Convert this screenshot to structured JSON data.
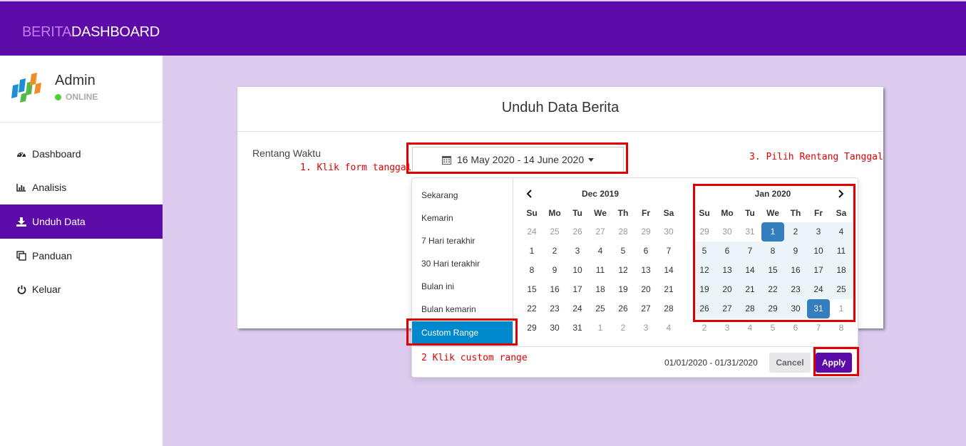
{
  "app": {
    "brand_part1": "BERITA",
    "brand_part2": "DASHBOARD"
  },
  "user": {
    "name": "Admin",
    "status": "ONLINE"
  },
  "sidebar": {
    "items": [
      {
        "label": "Dashboard",
        "icon": "dashboard-icon"
      },
      {
        "label": "Analisis",
        "icon": "bar-chart-icon"
      },
      {
        "label": "Unduh Data",
        "icon": "download-icon",
        "active": true
      },
      {
        "label": "Panduan",
        "icon": "copy-icon"
      },
      {
        "label": "Keluar",
        "icon": "power-icon"
      }
    ]
  },
  "card": {
    "title": "Unduh Data Berita",
    "field_label": "Rentang Waktu",
    "date_value": "16 May 2020 - 14 June 2020"
  },
  "annotations": {
    "step1": "1. Klik form tanggal",
    "step2": "2 Klik custom range",
    "step3": "3. Pilih Rentang Tanggal"
  },
  "picker": {
    "ranges": [
      "Sekarang",
      "Kemarin",
      "7 Hari terakhir",
      "30 Hari terakhir",
      "Bulan ini",
      "Bulan kemarin",
      "Custom Range"
    ],
    "active_range": "Custom Range",
    "dow": [
      "Su",
      "Mo",
      "Tu",
      "We",
      "Th",
      "Fr",
      "Sa"
    ],
    "left_month": "Dec 2019",
    "right_month": "Jan 2020",
    "left_days": [
      [
        "24",
        "o"
      ],
      [
        "25",
        "o"
      ],
      [
        "26",
        "o"
      ],
      [
        "27",
        "o"
      ],
      [
        "28",
        "o"
      ],
      [
        "29",
        "o"
      ],
      [
        "30",
        "o"
      ],
      [
        "1",
        ""
      ],
      [
        "2",
        ""
      ],
      [
        "3",
        ""
      ],
      [
        "4",
        ""
      ],
      [
        "5",
        ""
      ],
      [
        "6",
        ""
      ],
      [
        "7",
        ""
      ],
      [
        "8",
        ""
      ],
      [
        "9",
        ""
      ],
      [
        "10",
        ""
      ],
      [
        "11",
        ""
      ],
      [
        "12",
        ""
      ],
      [
        "13",
        ""
      ],
      [
        "14",
        ""
      ],
      [
        "15",
        ""
      ],
      [
        "16",
        ""
      ],
      [
        "17",
        ""
      ],
      [
        "18",
        ""
      ],
      [
        "19",
        ""
      ],
      [
        "20",
        ""
      ],
      [
        "21",
        ""
      ],
      [
        "22",
        ""
      ],
      [
        "23",
        ""
      ],
      [
        "24",
        ""
      ],
      [
        "25",
        ""
      ],
      [
        "26",
        ""
      ],
      [
        "27",
        ""
      ],
      [
        "28",
        ""
      ],
      [
        "29",
        ""
      ],
      [
        "30",
        ""
      ],
      [
        "31",
        ""
      ],
      [
        "1",
        "o"
      ],
      [
        "2",
        "o"
      ],
      [
        "3",
        "o"
      ],
      [
        "4",
        "o"
      ]
    ],
    "right_days": [
      [
        "29",
        "o"
      ],
      [
        "30",
        "o"
      ],
      [
        "31",
        "o"
      ],
      [
        "1",
        "s"
      ],
      [
        "2",
        "r"
      ],
      [
        "3",
        "r"
      ],
      [
        "4",
        "r"
      ],
      [
        "5",
        "r"
      ],
      [
        "6",
        "r"
      ],
      [
        "7",
        "r"
      ],
      [
        "8",
        "r"
      ],
      [
        "9",
        "r"
      ],
      [
        "10",
        "r"
      ],
      [
        "11",
        "r"
      ],
      [
        "12",
        "r"
      ],
      [
        "13",
        "r"
      ],
      [
        "14",
        "r"
      ],
      [
        "15",
        "r"
      ],
      [
        "16",
        "r"
      ],
      [
        "17",
        "r"
      ],
      [
        "18",
        "r"
      ],
      [
        "19",
        "r"
      ],
      [
        "20",
        "r"
      ],
      [
        "21",
        "r"
      ],
      [
        "22",
        "r"
      ],
      [
        "23",
        "r"
      ],
      [
        "24",
        "r"
      ],
      [
        "25",
        "r"
      ],
      [
        "26",
        "r"
      ],
      [
        "27",
        "r"
      ],
      [
        "28",
        "r"
      ],
      [
        "29",
        "r"
      ],
      [
        "30",
        "r"
      ],
      [
        "31",
        "s"
      ],
      [
        "1",
        "o"
      ],
      [
        "2",
        "o"
      ],
      [
        "3",
        "o"
      ],
      [
        "4",
        "o"
      ],
      [
        "5",
        "o"
      ],
      [
        "6",
        "o"
      ],
      [
        "7",
        "o"
      ],
      [
        "8",
        "o"
      ]
    ],
    "selected_text": "01/01/2020 - 01/31/2020",
    "cancel_label": "Cancel",
    "apply_label": "Apply"
  },
  "colors": {
    "primary": "#5c0aa8",
    "brand_accent": "#c07cf0",
    "annotation": "#e00000",
    "range_active": "#0088cc",
    "selected_day": "#357ebd"
  }
}
